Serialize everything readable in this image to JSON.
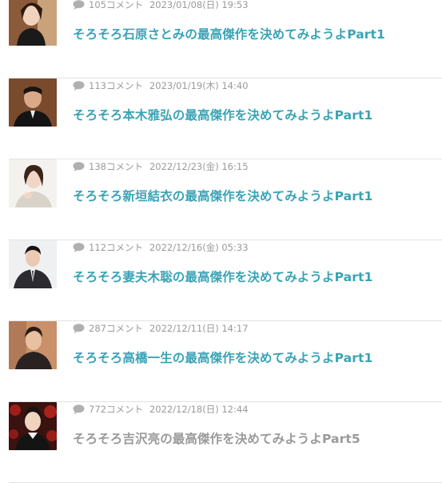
{
  "articles": [
    {
      "comment_count": "105コメント",
      "date": "2023/01/08(日) 19:53",
      "title": "そろそろ石原さとみの最高傑作を決めてみようよPart1",
      "visited": false,
      "thumbnail": "actress-photo"
    },
    {
      "comment_count": "113コメント",
      "date": "2023/01/19(木) 14:40",
      "title": "そろそろ本木雅弘の最高傑作を決めてみようよPart1",
      "visited": false,
      "thumbnail": "actor-photo"
    },
    {
      "comment_count": "138コメント",
      "date": "2022/12/23(金) 16:15",
      "title": "そろそろ新垣結衣の最高傑作を決めてみようよPart1",
      "visited": false,
      "thumbnail": "actress-photo"
    },
    {
      "comment_count": "112コメント",
      "date": "2022/12/16(金) 05:33",
      "title": "そろそろ妻夫木聡の最高傑作を決めてみようよPart1",
      "visited": false,
      "thumbnail": "actor-photo"
    },
    {
      "comment_count": "287コメント",
      "date": "2022/12/11(日) 14:17",
      "title": "そろそろ高橋一生の最高傑作を決めてみようよPart1",
      "visited": false,
      "thumbnail": "actor-photo"
    },
    {
      "comment_count": "772コメント",
      "date": "2022/12/18(日) 12:44",
      "title": "そろそろ吉沢亮の最高傑作を決めてみようよPart5",
      "visited": true,
      "thumbnail": "actor-photo"
    }
  ],
  "colors": {
    "link": "#39a3b6",
    "visited_link": "#9a9a9a",
    "meta": "#9a9a9a",
    "separator": "#e3e3e3"
  }
}
